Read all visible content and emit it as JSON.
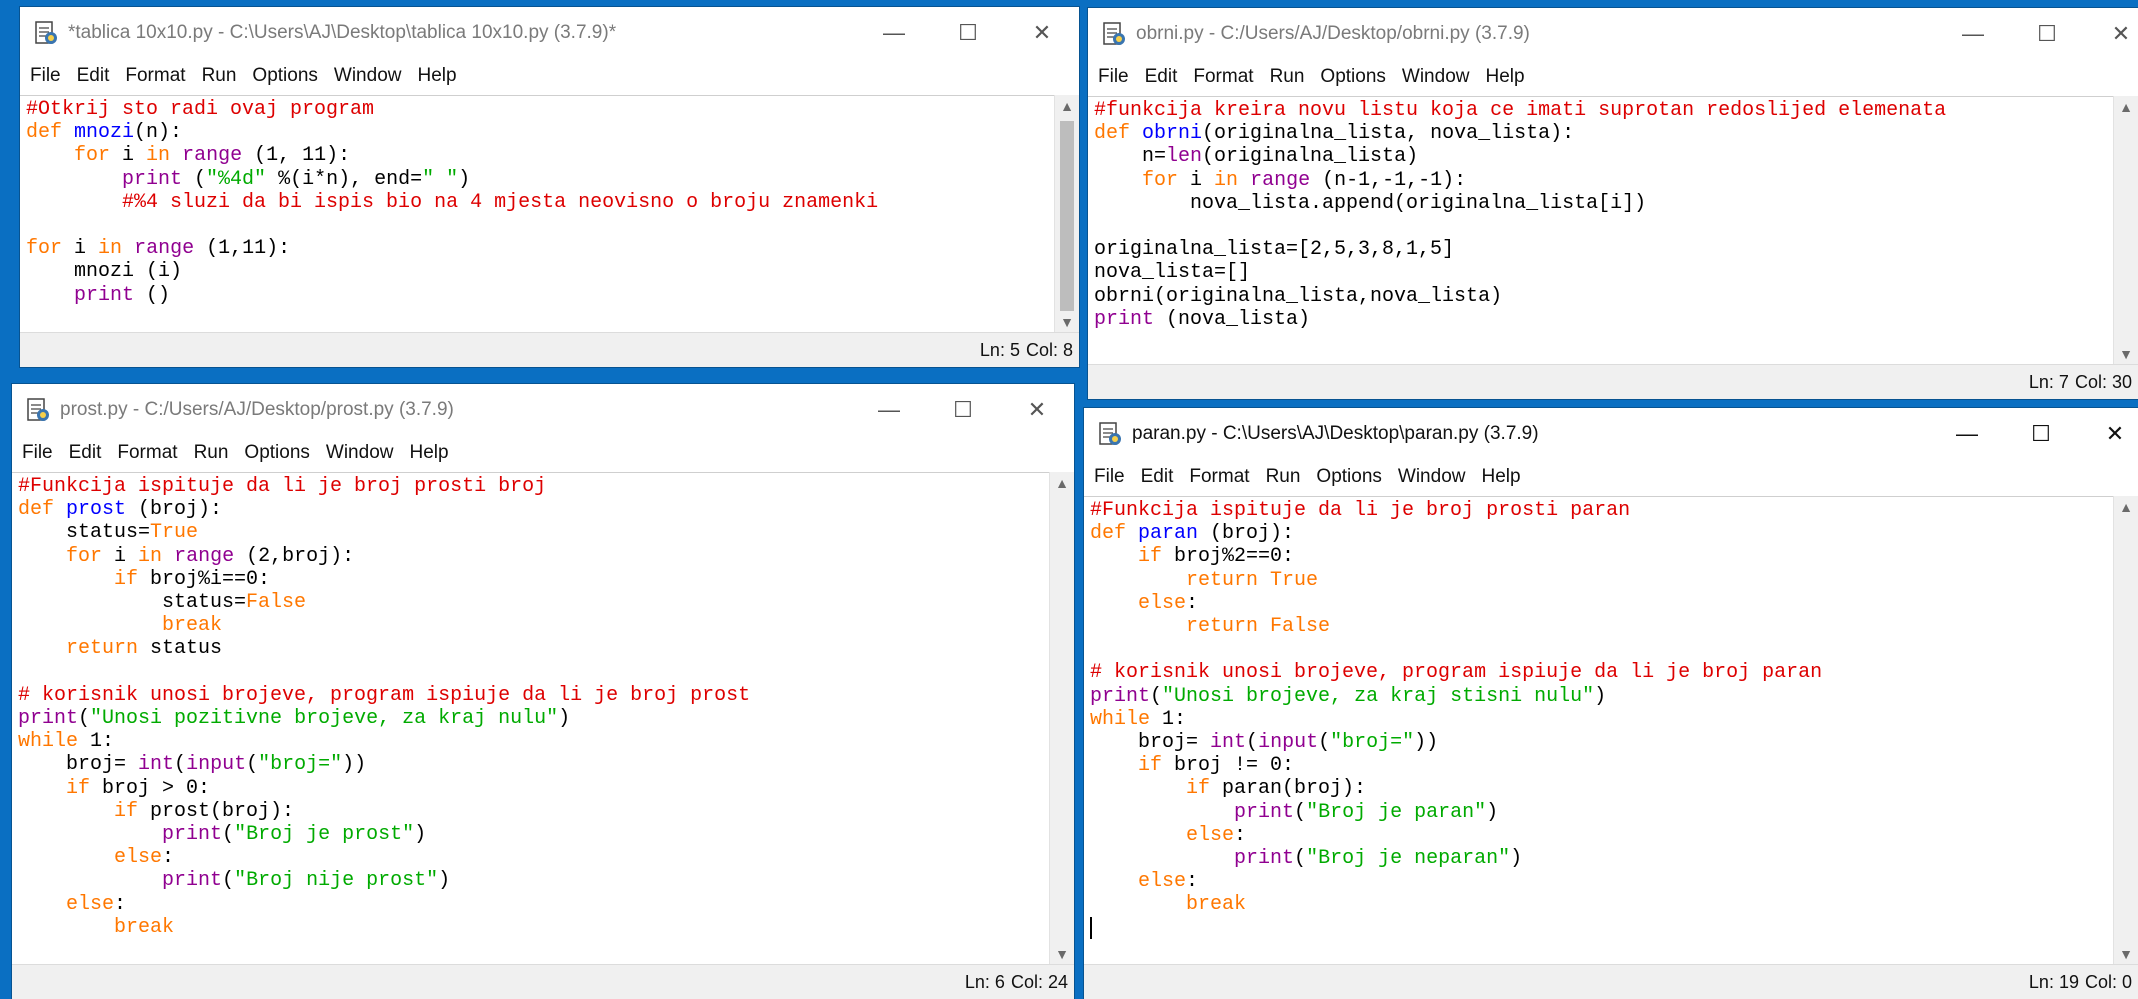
{
  "menu": [
    "File",
    "Edit",
    "Format",
    "Run",
    "Options",
    "Window",
    "Help"
  ],
  "windows": {
    "tablica": {
      "title": "*tablica 10x10.py - C:\\Users\\AJ\\Desktop\\tablica 10x10.py (3.7.9)*",
      "ln": "Ln: 5",
      "col": "Col: 8",
      "code": [
        "#Otkrij sto radi ovaj program",
        "def mnozi(n):",
        "    for i in range (1, 11):",
        "        print (\"%4d\" %(i*n), end=\" \")",
        "        #%4 sluzi da bi ispis bio na 4 mjesta neovisno o broju znamenki",
        "",
        "for i in range (1,11):",
        "    mnozi (i)",
        "    print ()"
      ]
    },
    "obrni": {
      "title": "obrni.py - C:/Users/AJ/Desktop/obrni.py (3.7.9)",
      "ln": "Ln: 7",
      "col": "Col: 30",
      "code": [
        "#funkcija kreira novu listu koja ce imati suprotan redoslijed elemenata",
        "def obrni(originalna_lista, nova_lista):",
        "    n=len(originalna_lista)",
        "    for i in range (n-1,-1,-1):",
        "        nova_lista.append(originalna_lista[i])",
        "",
        "originalna_lista=[2,5,3,8,1,5]",
        "nova_lista=[]",
        "obrni(originalna_lista,nova_lista)",
        "print (nova_lista)"
      ]
    },
    "prost": {
      "title": "prost.py - C:/Users/AJ/Desktop/prost.py (3.7.9)",
      "ln": "Ln: 6",
      "col": "Col: 24",
      "code": [
        "#Funkcija ispituje da li je broj prosti broj",
        "def prost (broj):",
        "    status=True",
        "    for i in range (2,broj):",
        "        if broj%i==0:",
        "            status=False",
        "            break",
        "    return status",
        "",
        "# korisnik unosi brojeve, program ispiuje da li je broj prost",
        "print(\"Unosi pozitivne brojeve, za kraj nulu\")",
        "while 1:",
        "    broj= int(input(\"broj=\"))",
        "    if broj > 0:",
        "        if prost(broj):",
        "            print(\"Broj je prost\")",
        "        else:",
        "            print(\"Broj nije prost\")",
        "    else:",
        "        break"
      ]
    },
    "paran": {
      "title": "paran.py - C:\\Users\\AJ\\Desktop\\paran.py (3.7.9)",
      "ln": "Ln: 19",
      "col": "Col: 0",
      "code": [
        "#Funkcija ispituje da li je broj prosti paran",
        "def paran (broj):",
        "    if broj%2==0:",
        "        return True",
        "    else:",
        "        return False",
        "",
        "# korisnik unosi brojeve, program ispiuje da li je broj paran",
        "print(\"Unosi brojeve, za kraj stisni nulu\")",
        "while 1:",
        "    broj= int(input(\"broj=\"))",
        "    if broj != 0:",
        "        if paran(broj):",
        "            print(\"Broj je paran\")",
        "        else:",
        "            print(\"Broj je neparan\")",
        "    else:",
        "        break",
        ""
      ]
    }
  }
}
